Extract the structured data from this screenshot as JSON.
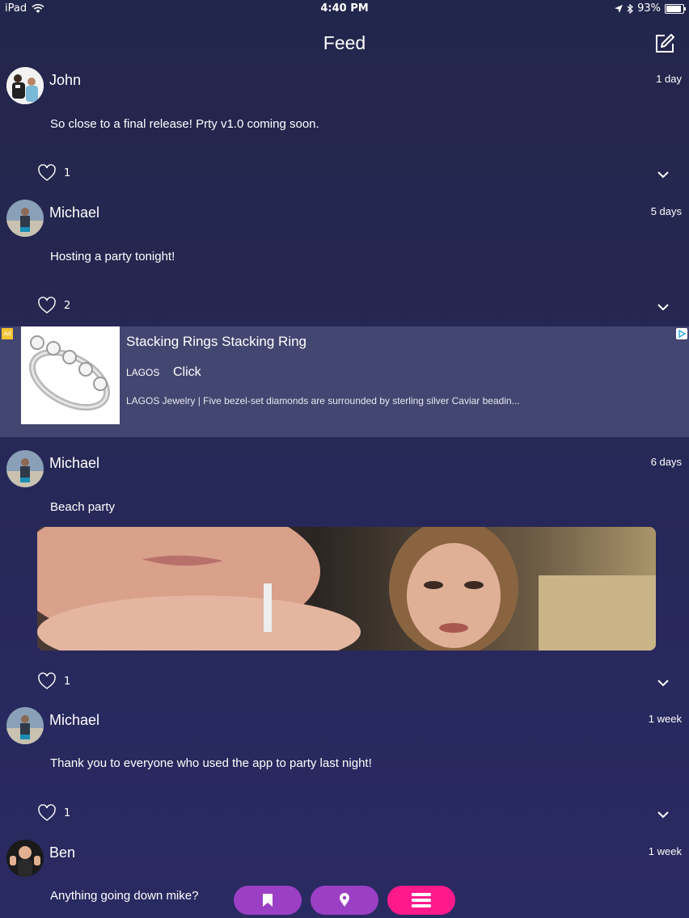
{
  "status_bar": {
    "device": "iPad",
    "time": "4:40 PM",
    "battery": "93%",
    "battery_level": 0.93
  },
  "nav": {
    "title": "Feed",
    "compose_icon": "compose-icon"
  },
  "posts": [
    {
      "name": "John",
      "time": "1 day",
      "text": "So close to a final release! Prty v1.0 coming soon.",
      "likes": "1"
    },
    {
      "name": "Michael",
      "time": "5 days",
      "text": "Hosting a party tonight!",
      "likes": "2"
    },
    {
      "name": "Michael",
      "time": "6 days",
      "text": "Beach party",
      "likes": "1"
    },
    {
      "name": "Michael",
      "time": "1 week",
      "text": "Thank you to everyone who used the app to party last night!",
      "likes": "1"
    },
    {
      "name": "Ben",
      "time": "1 week",
      "text": "Anything going down mike?"
    }
  ],
  "ad": {
    "badge": "Ad",
    "headline": "Stacking Rings Stacking Ring",
    "brand": "LAGOS",
    "cta": "Click",
    "description": "LAGOS Jewelry | Five bezel-set diamonds are surrounded by sterling silver Caviar beadin..."
  },
  "tabs": [
    {
      "icon": "bookmark-icon",
      "color": "#9b3fc4"
    },
    {
      "icon": "location-pin-icon",
      "color": "#9b3fc4"
    },
    {
      "icon": "menu-icon",
      "color": "#ff1a8c"
    }
  ],
  "colors": {
    "background": "#25274f",
    "ad_background": "#434670",
    "tab_purple": "#9b3fc4",
    "tab_pink": "#ff1a8c"
  }
}
